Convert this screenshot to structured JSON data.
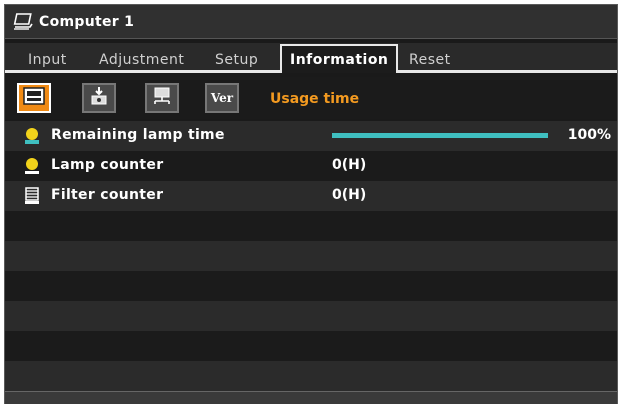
{
  "window": {
    "title": "Computer 1",
    "icon": "computer-monitor-icon"
  },
  "tabs": [
    {
      "label": "Input",
      "active": false
    },
    {
      "label": "Adjustment",
      "active": false
    },
    {
      "label": "Setup",
      "active": false
    },
    {
      "label": "Information",
      "active": true
    },
    {
      "label": "Reset",
      "active": false
    }
  ],
  "subtabs": [
    {
      "icon": "usage-time-icon",
      "active": true
    },
    {
      "icon": "source-icon",
      "active": false
    },
    {
      "icon": "network-icon",
      "active": false
    },
    {
      "icon": "version-icon",
      "label": "Ver",
      "active": false
    }
  ],
  "section_title": "Usage time",
  "rows": [
    {
      "label": "Remaining lamp time",
      "icon": "lamp-time-icon",
      "progress_percent": 100,
      "progress_label": "100%"
    },
    {
      "label": "Lamp counter",
      "icon": "lamp-counter-icon",
      "value": "0(H)"
    },
    {
      "label": "Filter counter",
      "icon": "filter-counter-icon",
      "value": "0(H)"
    }
  ],
  "colors": {
    "accent": "#f08a14",
    "progress": "#3fbfc0",
    "section_title": "#f39a20"
  }
}
